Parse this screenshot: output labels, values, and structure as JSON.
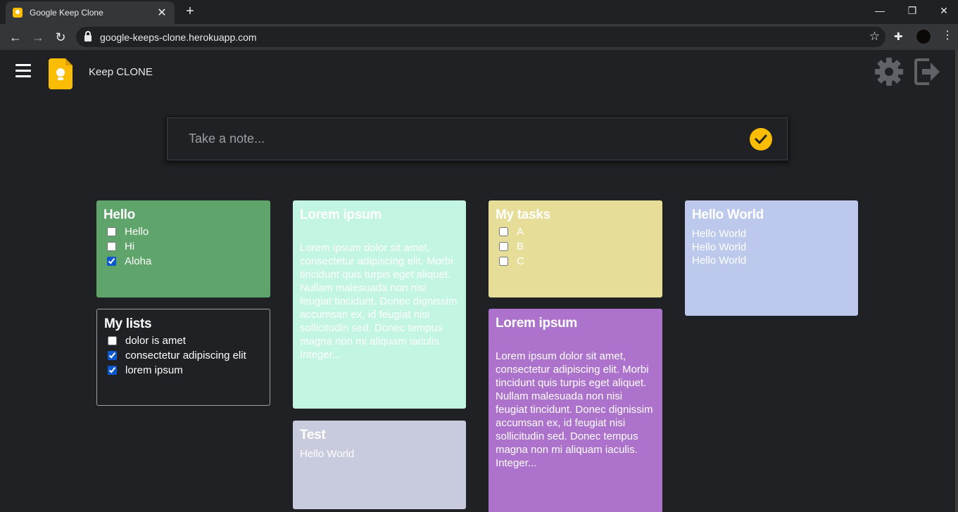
{
  "browser": {
    "tab_title": "Google Keep Clone",
    "tab_close": "✕",
    "new_tab": "+",
    "minimize": "—",
    "restore": "❐",
    "close": "✕",
    "back": "←",
    "forward": "→",
    "reload": "↻",
    "url": "google-keeps-clone.herokuapp.com",
    "star": "☆",
    "extensions": "✚",
    "menu": "⋮"
  },
  "header": {
    "brand": "Keep CLONE",
    "icons": [
      "menu-icon",
      "keep-logo-icon",
      "gear-icon",
      "logout-icon"
    ]
  },
  "note_input": {
    "placeholder": "Take a note..."
  },
  "notes": {
    "hello": {
      "title": "Hello",
      "color": "#5fa56b",
      "items": [
        {
          "label": "Hello",
          "checked": false
        },
        {
          "label": "Hi",
          "checked": false
        },
        {
          "label": "Aloha",
          "checked": true
        }
      ]
    },
    "mylists": {
      "title": "My lists",
      "color": "#202124",
      "items": [
        {
          "label": "dolor is amet",
          "checked": false
        },
        {
          "label": "consectetur adipiscing elit",
          "checked": true
        },
        {
          "label": "lorem ipsum",
          "checked": true
        }
      ]
    },
    "lorem1": {
      "title": "Lorem ipsum",
      "color": "#c2f6e2",
      "body": "Lorem ipsum dolor sit amet, consectetur adipiscing elit. Morbi tincidunt quis turpis eget aliquet. Nullam malesuada non nisi feugiat tincidunt. Donec dignissim accumsan ex, id feugiat nisi sollicitudin sed. Donec tempus magna non mi aliquam iaculis. Integer..."
    },
    "test": {
      "title": "Test",
      "color": "#c8cadd",
      "body": "Hello World"
    },
    "mytasks": {
      "title": "My tasks",
      "color": "#e6dd98",
      "items": [
        {
          "label": "A",
          "checked": false
        },
        {
          "label": "B",
          "checked": false
        },
        {
          "label": "C",
          "checked": false
        }
      ]
    },
    "lorem2": {
      "title": "Lorem ipsum",
      "color": "#ad72cc",
      "body": "Lorem ipsum dolor sit amet, consectetur adipiscing elit. Morbi tincidunt quis turpis eget aliquet. Nullam malesuada non nisi feugiat tincidunt. Donec dignissim accumsan ex, id feugiat nisi sollicitudin sed. Donec tempus magna non mi aliquam iaculis. Integer..."
    },
    "helloworld": {
      "title": "Hello World",
      "color": "#bcc9ec",
      "body": "Hello World\nHello World\nHello World"
    }
  },
  "colors": {
    "accent": "#fbbc04",
    "background": "#202124"
  }
}
